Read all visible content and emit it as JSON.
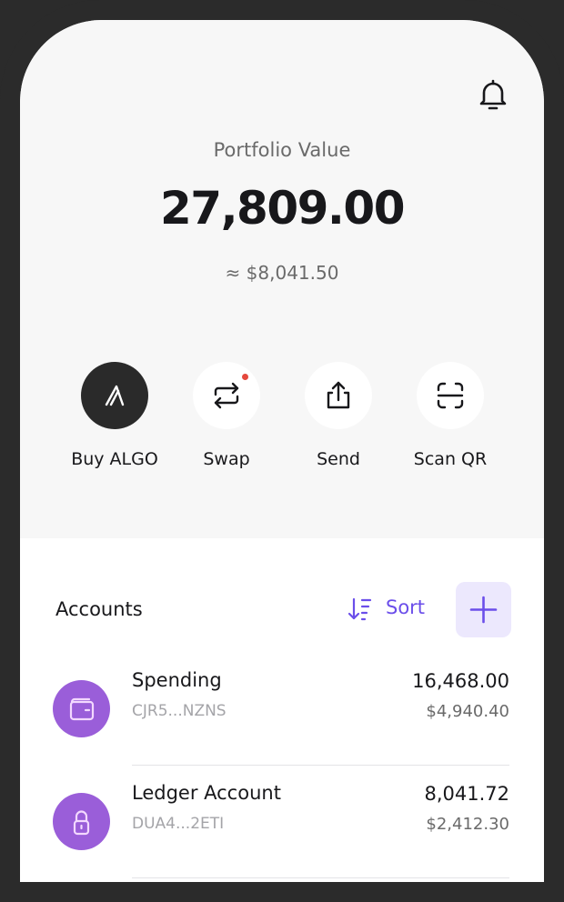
{
  "portfolio": {
    "label": "Portfolio Value",
    "value": "27,809.00",
    "usd": "≈ $8,041.50"
  },
  "icons": {
    "notifications": "bell-icon"
  },
  "actions": [
    {
      "label": "Buy ALGO",
      "icon": "algo-icon"
    },
    {
      "label": "Swap",
      "icon": "swap-icon",
      "badge": "red-dot"
    },
    {
      "label": "Send",
      "icon": "send-icon"
    },
    {
      "label": "Scan QR",
      "icon": "scan-qr-icon"
    }
  ],
  "accounts": {
    "title": "Accounts",
    "sort_label": "Sort",
    "items": [
      {
        "name": "Spending",
        "address": "CJR5...NZNS",
        "balance": "16,468.00",
        "usd": "$4,940.40",
        "icon": "wallet-icon"
      },
      {
        "name": "Ledger Account",
        "address": "DUA4...2ETI",
        "balance": "8,041.72",
        "usd": "$2,412.30",
        "icon": "ledger-lock-icon"
      }
    ]
  },
  "colors": {
    "accent": "#6b4eea",
    "accent_soft": "#ece8fd",
    "avatar": "#9a5ed9",
    "badge": "#e5483d"
  }
}
